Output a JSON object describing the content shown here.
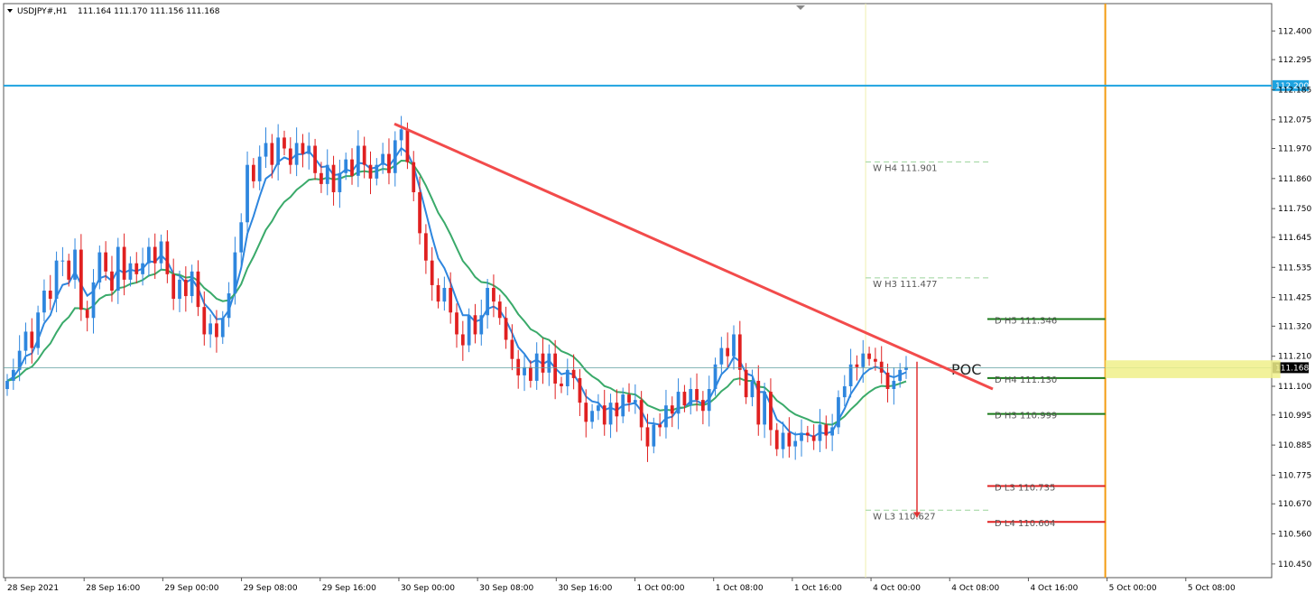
{
  "header": {
    "symbol_timeframe": "USDJPY#,H1",
    "ohlc": "111.164 111.170 111.156 111.168"
  },
  "chart_data": {
    "type": "candlestick",
    "symbol": "USDJPY#",
    "timeframe": "H1",
    "ylim": [
      110.4,
      112.5
    ],
    "y_ticks": [
      112.4,
      112.295,
      112.185,
      112.075,
      111.97,
      111.86,
      111.75,
      111.645,
      111.535,
      111.425,
      111.32,
      111.21,
      111.1,
      110.995,
      110.885,
      110.775,
      110.67,
      110.56,
      110.45
    ],
    "x_labels": [
      "28 Sep 2021",
      "28 Sep 16:00",
      "29 Sep 00:00",
      "29 Sep 08:00",
      "29 Sep 16:00",
      "30 Sep 00:00",
      "30 Sep 08:00",
      "30 Sep 16:00",
      "1 Oct 00:00",
      "1 Oct 08:00",
      "1 Oct 16:00",
      "4 Oct 00:00",
      "4 Oct 08:00",
      "4 Oct 16:00",
      "5 Oct 00:00",
      "5 Oct 08:00"
    ],
    "current_price": "111.168",
    "resistance_level": "112.200",
    "weekly_pivots": [
      {
        "label": "W  H4 111.901",
        "value": 111.901
      },
      {
        "label": "W  H3 111.477",
        "value": 111.477
      },
      {
        "label": "W  L3 110.627",
        "value": 110.627
      }
    ],
    "daily_pivots": [
      {
        "label": "D  H5 111.346",
        "value": 111.346,
        "color": "#1a7a1a"
      },
      {
        "label": "D  H4 111.130",
        "value": 111.13,
        "color": "#1a7a1a"
      },
      {
        "label": "D  H3 110.999",
        "value": 110.999,
        "color": "#1a7a1a"
      },
      {
        "label": "D  L3 110.735",
        "value": 110.735,
        "color": "#e02020"
      },
      {
        "label": "D  L4 110.604",
        "value": 110.604,
        "color": "#e02020"
      }
    ],
    "poc_label": "POC",
    "poc_zone": [
      111.13,
      111.195
    ],
    "trendline": {
      "from_value": 112.06,
      "to_value": 111.09
    },
    "target_arrow": {
      "from_value": 111.19,
      "to_value": 110.62
    },
    "candles_close": [
      111.12,
      111.16,
      111.23,
      111.3,
      111.24,
      111.37,
      111.45,
      111.42,
      111.56,
      111.56,
      111.49,
      111.6,
      111.38,
      111.35,
      111.48,
      111.59,
      111.52,
      111.45,
      111.61,
      111.49,
      111.55,
      111.51,
      111.55,
      111.61,
      111.55,
      111.63,
      111.51,
      111.42,
      111.49,
      111.43,
      111.52,
      111.39,
      111.29,
      111.33,
      111.28,
      111.35,
      111.44,
      111.59,
      111.7,
      111.91,
      111.85,
      111.94,
      111.99,
      111.91,
      112.01,
      111.97,
      111.91,
      111.99,
      111.95,
      111.98,
      111.88,
      111.84,
      111.91,
      111.81,
      111.88,
      111.93,
      111.87,
      111.98,
      111.91,
      111.86,
      111.91,
      111.95,
      111.88,
      112.0,
      112.04,
      111.92,
      111.81,
      111.66,
      111.56,
      111.47,
      111.41,
      111.46,
      111.37,
      111.29,
      111.25,
      111.36,
      111.29,
      111.36,
      111.46,
      111.41,
      111.35,
      111.27,
      111.2,
      111.14,
      111.17,
      111.12,
      111.22,
      111.15,
      111.22,
      111.11,
      111.1,
      111.16,
      111.13,
      111.04,
      110.97,
      111.01,
      111.03,
      110.96,
      111.04,
      110.99,
      111.07,
      111.04,
      111.05,
      110.95,
      110.88,
      110.96,
      110.95,
      111.03,
      111.0,
      111.08,
      111.03,
      111.09,
      111.05,
      111.01,
      111.09,
      111.18,
      111.24,
      111.21,
      111.29,
      111.16,
      111.06,
      111.12,
      110.96,
      111.08,
      110.94,
      110.87,
      110.93,
      110.88,
      110.9,
      110.93,
      110.92,
      110.9,
      110.96,
      110.92,
      110.95,
      111.06,
      111.1,
      111.18,
      111.17,
      111.22,
      111.2,
      111.19,
      111.15,
      111.09,
      111.12,
      111.16,
      111.17
    ],
    "emas": [
      {
        "name": "fast",
        "color": "#2e86de"
      },
      {
        "name": "slow",
        "color": "#3aaa6a"
      }
    ]
  }
}
